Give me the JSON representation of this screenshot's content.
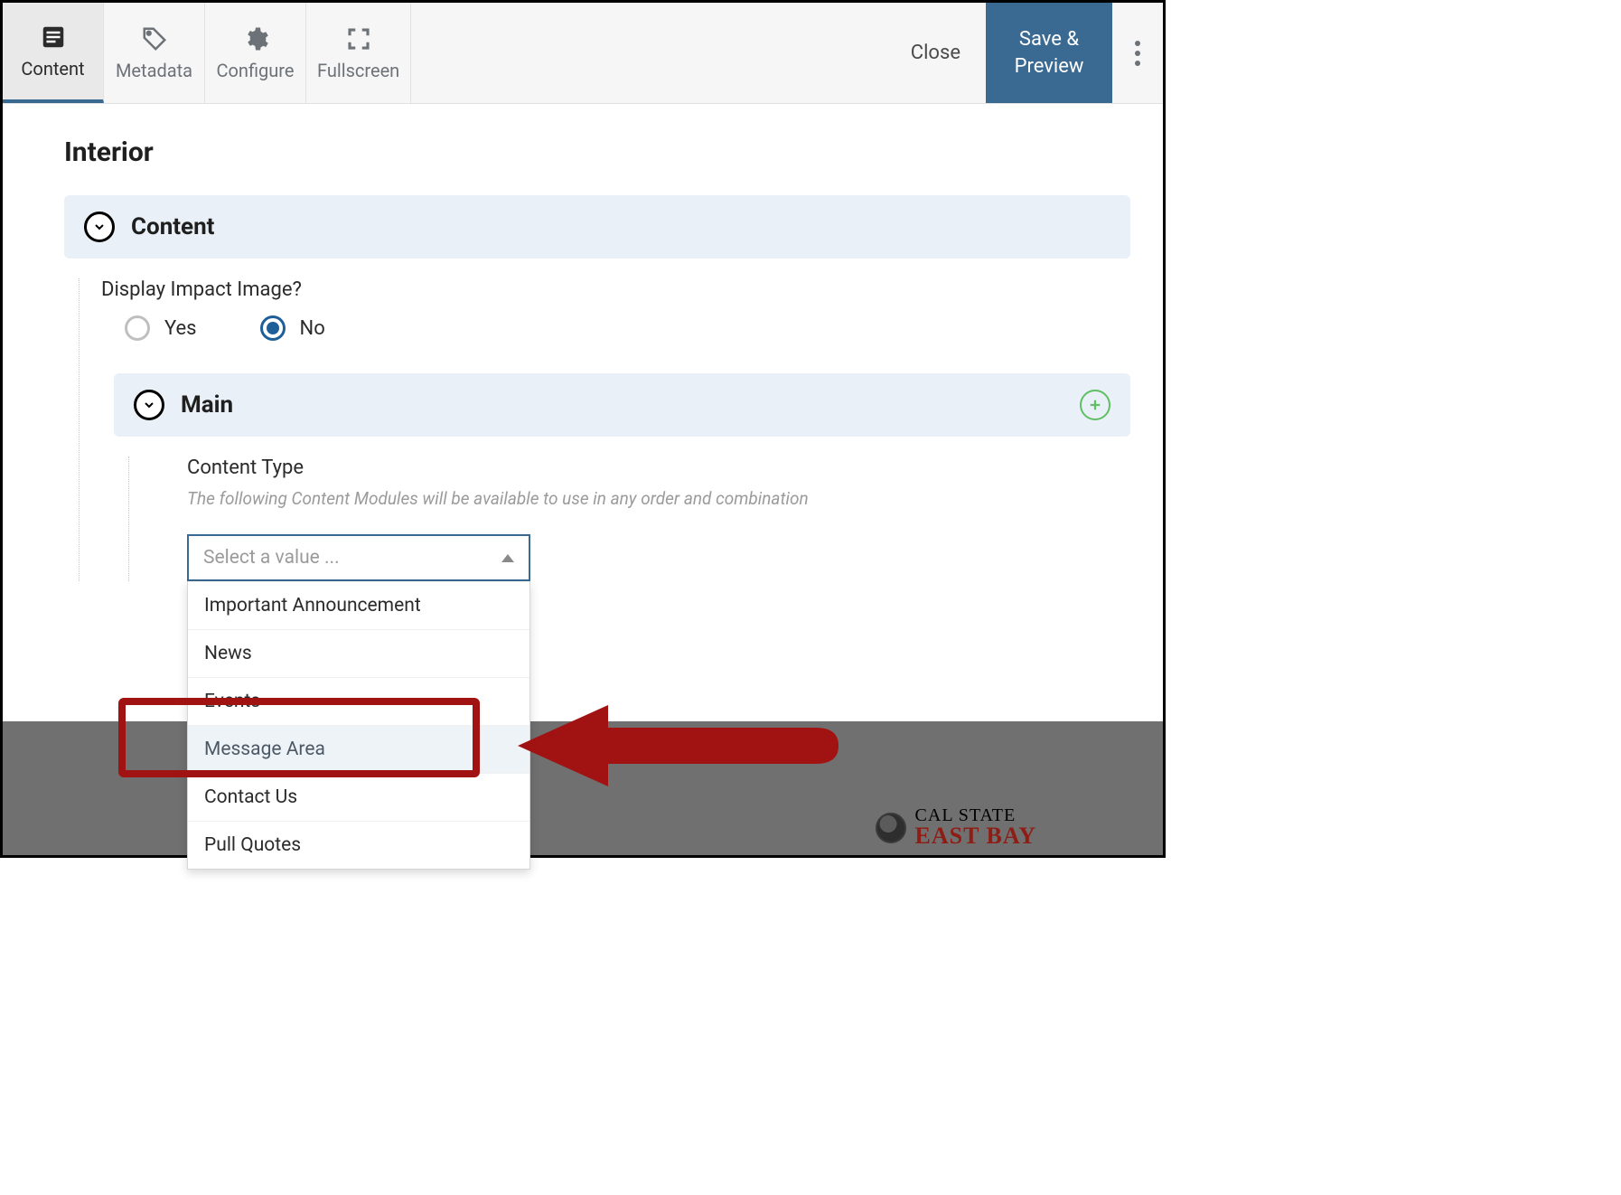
{
  "toolbar": {
    "tabs": [
      {
        "label": "Content",
        "active": true
      },
      {
        "label": "Metadata",
        "active": false
      },
      {
        "label": "Configure",
        "active": false
      },
      {
        "label": "Fullscreen",
        "active": false
      }
    ],
    "close_label": "Close",
    "save_label": "Save &\nPreview"
  },
  "page_title": "Interior",
  "content_section": {
    "title": "Content"
  },
  "display_impact": {
    "question": "Display Impact Image?",
    "options": [
      "Yes",
      "No"
    ],
    "selected": "No"
  },
  "main_section": {
    "title": "Main"
  },
  "content_type": {
    "label": "Content Type",
    "description": "The following Content Modules will be available to use in any order and combination",
    "placeholder": "Select a value ...",
    "options": [
      "Important Announcement",
      "News",
      "Events",
      "Message Area",
      "Contact Us",
      "Pull Quotes"
    ],
    "highlighted": "Message Area"
  },
  "footer": {
    "line1": "CAL STATE",
    "line2": "EAST BAY"
  }
}
